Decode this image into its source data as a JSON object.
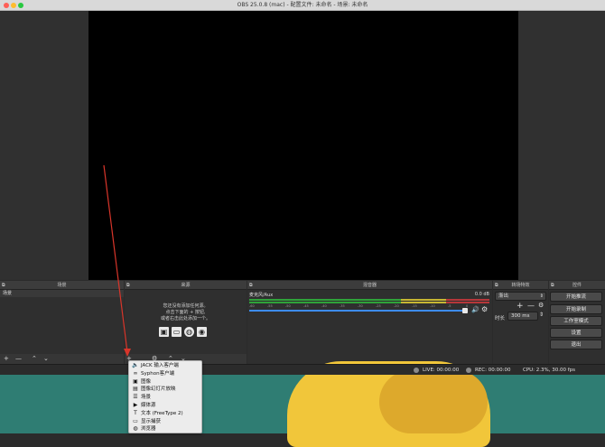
{
  "window": {
    "title": "OBS 25.0.8 (mac) - 配置文件: 未命名 - 场景: 未命名",
    "traffic_colors": [
      "#ff5f57",
      "#febc2e",
      "#28c840"
    ]
  },
  "docks": {
    "scenes": {
      "title": "场景",
      "subheader": "场景"
    },
    "sources": {
      "title": "来源",
      "empty_lines": [
        "您还没有添加任何源。",
        "点击下面的 + 按钮,",
        "或者右击此处添加一个。"
      ]
    },
    "mixer": {
      "title": "混音器",
      "channel": "麦克风/Aux",
      "db": "0.0 dB",
      "ticks": [
        "-60",
        "-55",
        "-50",
        "-45",
        "-40",
        "-35",
        "-30",
        "-25",
        "-20",
        "-15",
        "-10",
        "-5",
        "0"
      ]
    },
    "transitions": {
      "title": "转场特效",
      "selected": "渐出",
      "duration_label": "时长",
      "duration_value": "300 ms"
    },
    "controls": {
      "title": "控件",
      "buttons": [
        "开始推流",
        "开始录制",
        "工作室模式",
        "设置",
        "退出"
      ]
    }
  },
  "status": {
    "live": "LIVE: 00:00:00",
    "rec": "REC: 00:00:00",
    "cpu": "CPU: 2.3%, 30.00 fps"
  },
  "add_source_menu": {
    "items": [
      {
        "icon": "speaker-icon",
        "glyph": "🔈",
        "label": "JACK 输入客户端"
      },
      {
        "icon": "link-icon",
        "glyph": "∞",
        "label": "Syphon客户端"
      },
      {
        "icon": "image-icon",
        "glyph": "▣",
        "label": "图像"
      },
      {
        "icon": "slideshow-icon",
        "glyph": "▤",
        "label": "图像幻灯片放映"
      },
      {
        "icon": "scene-icon",
        "glyph": "☰",
        "label": "场景"
      },
      {
        "icon": "play-icon",
        "glyph": "▶",
        "label": "媒体源"
      },
      {
        "icon": "text-icon",
        "glyph": "T",
        "label": "文本 (FreeType 2)"
      },
      {
        "icon": "monitor-icon",
        "glyph": "▭",
        "label": "显示捕获"
      },
      {
        "icon": "globe-icon",
        "glyph": "◍",
        "label": "浏览器"
      }
    ]
  },
  "colors": {
    "arrow": "#d8352a",
    "volume_slider": "#3d8cf5",
    "live_dot": "#8a8a8a"
  }
}
